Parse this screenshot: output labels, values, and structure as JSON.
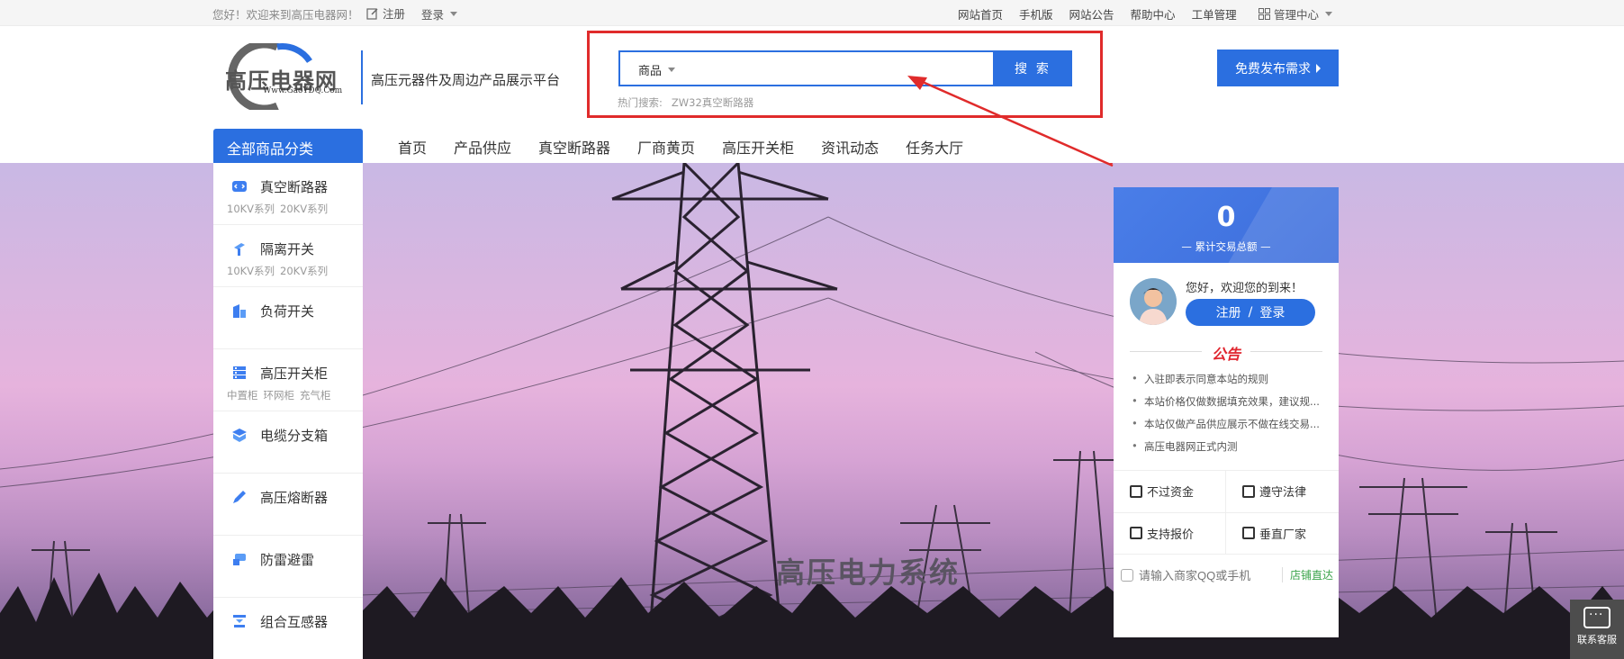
{
  "topbar": {
    "welcome": "您好！欢迎来到高压电器网！",
    "register": "注册",
    "login": "登录",
    "links": [
      "网站首页",
      "手机版",
      "网站公告",
      "帮助中心",
      "工单管理"
    ],
    "management": "管理中心"
  },
  "header": {
    "logo_text": "高压电器网",
    "logo_sub": "Www.GaoYDQ.Com",
    "tagline": "高压元器件及周边产品展示平台",
    "search_category": "商品",
    "search_value": "",
    "search_button": "搜 索",
    "hot_label": "热门搜索:",
    "hot_terms": [
      "ZW32真空断路器"
    ],
    "publish_button": "免费发布需求"
  },
  "nav": {
    "all_categories": "全部商品分类",
    "items": [
      "首页",
      "产品供应",
      "真空断路器",
      "厂商黄页",
      "高压开关柜",
      "资讯动态",
      "任务大厅"
    ]
  },
  "categories": [
    {
      "name": "真空断路器",
      "icon": "code-icon",
      "subs": [
        "10KV系列",
        "20KV系列"
      ]
    },
    {
      "name": "隔离开关",
      "icon": "switch-icon",
      "subs": [
        "10KV系列",
        "20KV系列"
      ]
    },
    {
      "name": "负荷开关",
      "icon": "building-icon",
      "subs": []
    },
    {
      "name": "高压开关柜",
      "icon": "cabinet-icon",
      "subs": [
        "中置柜",
        "环网柜",
        "充气柜"
      ]
    },
    {
      "name": "电缆分支箱",
      "icon": "box-icon",
      "subs": []
    },
    {
      "name": "高压熔断器",
      "icon": "pen-icon",
      "subs": []
    },
    {
      "name": "防雷避雷",
      "icon": "shield-icon",
      "subs": []
    },
    {
      "name": "组合互感器",
      "icon": "transformer-icon",
      "subs": []
    }
  ],
  "banner": {
    "title": "高压电力系统"
  },
  "panel": {
    "stat_value": "0",
    "stat_label": "累计交易总额",
    "greeting": "您好，欢迎您的到来！",
    "register": "注册",
    "separator": "/",
    "login": "登录",
    "notice_title": "公告",
    "notices": [
      "入驻即表示同意本站的规则",
      "本站价格仅做数据填充效果，建议规...",
      "本站仅做产品供应展示不做在线交易...",
      "高压电器网正式内测"
    ],
    "features": [
      "不过资金",
      "遵守法律",
      "支持报价",
      "垂直厂家"
    ],
    "shop_placeholder": "请输入商家QQ或手机",
    "shop_button": "店铺直达"
  },
  "service": {
    "label": "联系客服"
  },
  "colors": {
    "accent": "#2b6fe0",
    "annotation": "#e02b2b",
    "notice": "#e0262f"
  }
}
